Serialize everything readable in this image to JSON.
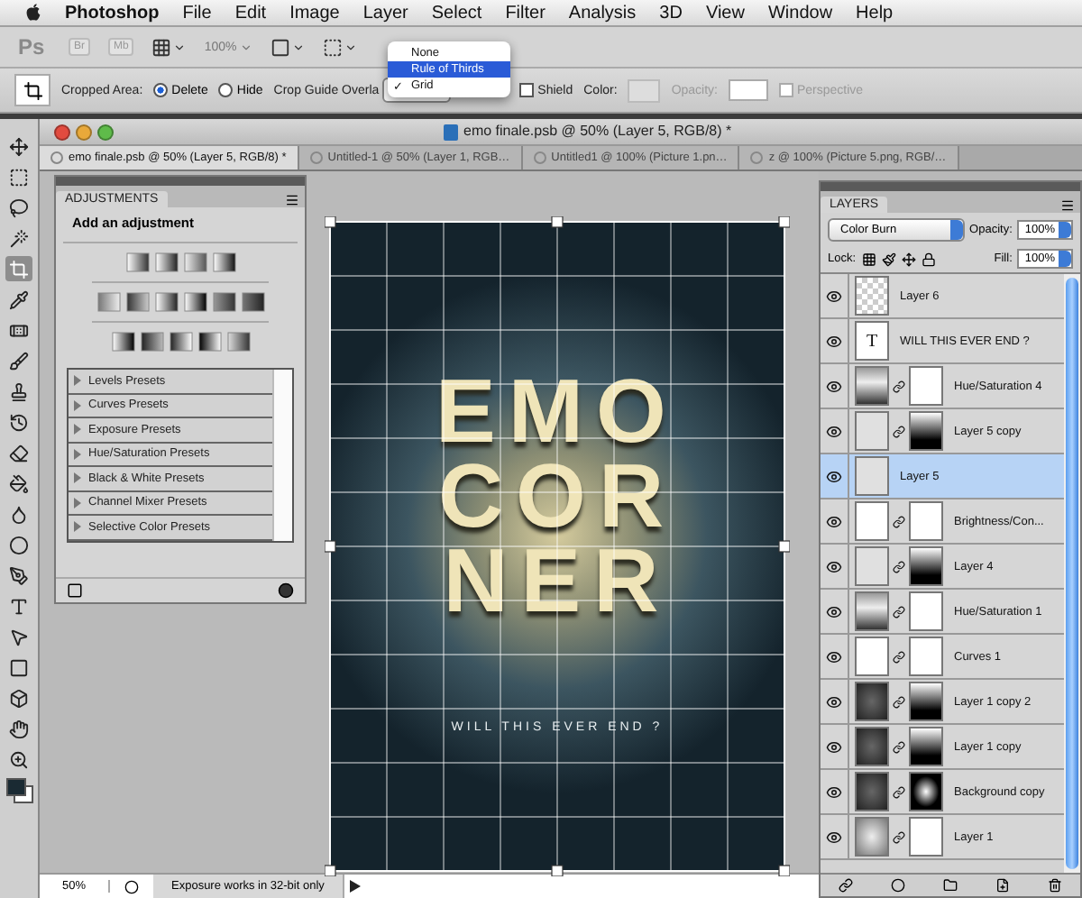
{
  "menu_bar": {
    "app": "Photoshop",
    "items": [
      "File",
      "Edit",
      "Image",
      "Layer",
      "Select",
      "Filter",
      "Analysis",
      "3D",
      "View",
      "Window",
      "Help"
    ]
  },
  "app_bar": {
    "logo": "Ps",
    "bridge": "Br",
    "mini_bridge": "Mb",
    "zoom": "100%"
  },
  "options_bar": {
    "cropped_area_label": "Cropped Area:",
    "cropped_area_options": [
      {
        "label": "Delete",
        "selected": true
      },
      {
        "label": "Hide",
        "selected": false
      }
    ],
    "crop_guide_label": "Crop Guide Overla",
    "shield": {
      "label": "Shield",
      "checked": false
    },
    "color_label": "Color:",
    "opacity_label": "Opacity:",
    "perspective": {
      "label": "Perspective",
      "checked": false,
      "disabled": true
    }
  },
  "crop_guide_menu": {
    "mark": "✓",
    "items": [
      {
        "label": "None",
        "selected": false,
        "checked": false
      },
      {
        "label": "Rule of Thirds",
        "selected": true,
        "checked": false
      },
      {
        "label": "Grid",
        "selected": false,
        "checked": true
      }
    ]
  },
  "toolbar": {
    "tools": [
      {
        "kind": "move",
        "selected": false
      },
      {
        "kind": "marquee",
        "selected": false
      },
      {
        "kind": "lasso",
        "selected": false
      },
      {
        "kind": "wand",
        "selected": false
      },
      {
        "kind": "crop",
        "selected": true
      },
      {
        "kind": "eyedropper",
        "selected": false
      },
      {
        "kind": "bandage",
        "selected": false
      },
      {
        "kind": "brush",
        "selected": false
      },
      {
        "kind": "stamp",
        "selected": false
      },
      {
        "kind": "history",
        "selected": false
      },
      {
        "kind": "eraser",
        "selected": false
      },
      {
        "kind": "bucket",
        "selected": false
      },
      {
        "kind": "droplet",
        "selected": false
      },
      {
        "kind": "dodge",
        "selected": false
      },
      {
        "kind": "pen",
        "selected": false
      },
      {
        "kind": "type",
        "selected": false
      },
      {
        "kind": "pointer",
        "selected": false
      },
      {
        "kind": "shape",
        "selected": false
      },
      {
        "kind": "cube",
        "selected": false
      },
      {
        "kind": "hand",
        "selected": false
      },
      {
        "kind": "zoom",
        "selected": false
      }
    ]
  },
  "document": {
    "title": "emo finale.psb @ 50% (Layer 5, RGB/8) *",
    "tabs": [
      {
        "label": "emo finale.psb @ 50% (Layer 5, RGB/8) *",
        "selected": true
      },
      {
        "label": "Untitled-1 @ 50% (Layer 1, RGB…",
        "selected": false
      },
      {
        "label": "Untitled1 @ 100% (Picture 1.pn…",
        "selected": false
      },
      {
        "label": "z @ 100% (Picture 5.png, RGB/…",
        "selected": false
      }
    ],
    "artwork": {
      "lines": [
        "EMO",
        "COR",
        "NER"
      ],
      "tagline": "WILL THIS EVER END ?"
    }
  },
  "adjustments": {
    "title": "ADJUSTMENTS",
    "heading": "Add an adjustment",
    "presets": [
      {
        "label": "Levels Presets",
        "expanded": false
      },
      {
        "label": "Curves Presets",
        "expanded": false
      },
      {
        "label": "Exposure Presets",
        "expanded": false
      },
      {
        "label": "Hue/Saturation Presets",
        "expanded": false
      },
      {
        "label": "Black & White Presets",
        "expanded": false
      },
      {
        "label": "Channel Mixer Presets",
        "expanded": false
      },
      {
        "label": "Selective Color Presets",
        "expanded": false
      }
    ]
  },
  "layers": {
    "title": "LAYERS",
    "blend_mode": "Color Burn",
    "opacity_label": "Opacity:",
    "opacity": "100%",
    "lock_label": "Lock:",
    "fill_label": "Fill:",
    "fill": "100%",
    "rows": [
      {
        "name": "Layer 6",
        "kind": "transparent",
        "visible": true,
        "selected": false
      },
      {
        "name": "WILL THIS EVER END ?",
        "kind": "text",
        "glyph": "T",
        "visible": true,
        "selected": false
      },
      {
        "name": "Hue/Saturation 4",
        "kind": "hue",
        "mask": {
          "kind": "white"
        },
        "visible": true,
        "selected": false
      },
      {
        "name": "Layer 5 copy",
        "kind": "light",
        "mask": {
          "kind": "fade"
        },
        "visible": true,
        "selected": false
      },
      {
        "name": "Layer 5",
        "kind": "light",
        "visible": true,
        "selected": true
      },
      {
        "name": "Brightness/Con...",
        "kind": "brightness",
        "mask": {
          "kind": "white"
        },
        "visible": true,
        "selected": false
      },
      {
        "name": "Layer 4",
        "kind": "light",
        "mask": {
          "kind": "fade"
        },
        "visible": true,
        "selected": false
      },
      {
        "name": "Hue/Saturation 1",
        "kind": "hue",
        "mask": {
          "kind": "white"
        },
        "visible": true,
        "selected": false
      },
      {
        "name": "Curves 1",
        "kind": "curves",
        "mask": {
          "kind": "white"
        },
        "visible": true,
        "selected": false
      },
      {
        "name": "Layer 1 copy 2",
        "kind": "dark",
        "mask": {
          "kind": "fade"
        },
        "visible": true,
        "selected": false
      },
      {
        "name": "Layer 1 copy",
        "kind": "dark",
        "mask": {
          "kind": "fade"
        },
        "visible": true,
        "selected": false
      },
      {
        "name": "Background copy",
        "kind": "dark",
        "mask": {
          "kind": "radial"
        },
        "visible": true,
        "selected": false
      },
      {
        "name": "Layer 1",
        "kind": "grey",
        "mask": {
          "kind": "white"
        },
        "visible": true,
        "selected": false
      }
    ]
  },
  "status_bar": {
    "zoom": "50%",
    "message": "Exposure works in 32-bit only"
  }
}
